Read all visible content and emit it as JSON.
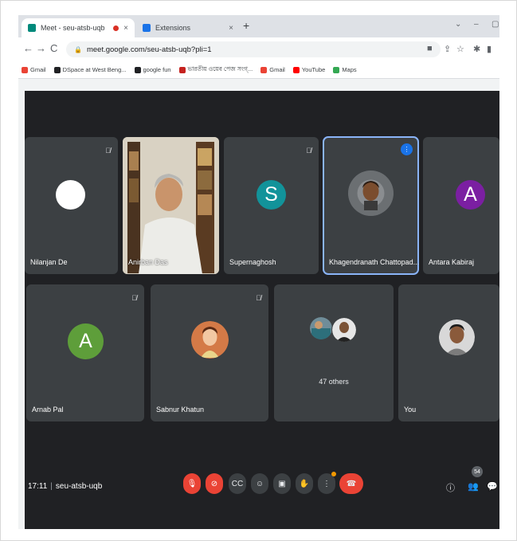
{
  "browser": {
    "tabs": [
      {
        "label": "Meet - seu-atsb-uqb",
        "close": "×"
      },
      {
        "label": "Extensions",
        "close": "×"
      }
    ],
    "new_tab": "+",
    "url": "meet.google.com/seu-atsb-uqb?pli=1",
    "nav": {
      "back": "←",
      "forward": "→",
      "reload": "C"
    },
    "bookmarks": [
      {
        "label": "Gmail",
        "color": "#ea4335"
      },
      {
        "label": "DSpace at West Beng...",
        "color": "#202124"
      },
      {
        "label": "google fun",
        "color": "#202124"
      },
      {
        "label": "ভারতীয় ওয়েব পেজ সংগ্...",
        "color": "#c5221f"
      },
      {
        "label": "Gmail",
        "color": "#ea4335"
      },
      {
        "label": "YouTube",
        "color": "#ff0000"
      },
      {
        "label": "Maps",
        "color": "#34a853"
      }
    ]
  },
  "meet": {
    "participants_row1": [
      {
        "name": "Nilanjan De",
        "avatar_color": "#ffffff",
        "initial": ""
      },
      {
        "name": "Anirban Das"
      },
      {
        "name": "Supernaghosh",
        "avatar_color": "#12939a",
        "initial": "S"
      },
      {
        "name": "Khagendranath Chattopad..."
      },
      {
        "name": "Antara Kabiraj",
        "avatar_color": "#7b1fa2",
        "initial": "A"
      }
    ],
    "participants_row2": [
      {
        "name": "Arnab Pal",
        "avatar_color": "#5e9e3a",
        "initial": "A"
      },
      {
        "name": "Sabnur Khatun"
      },
      {
        "name": "47 others"
      },
      {
        "name": "You"
      }
    ],
    "time": "17:11",
    "separator": "|",
    "meeting_code": "seu-atsb-uqb",
    "participant_count": "54",
    "accent": "#8ab4f8",
    "danger": "#ea4335"
  }
}
